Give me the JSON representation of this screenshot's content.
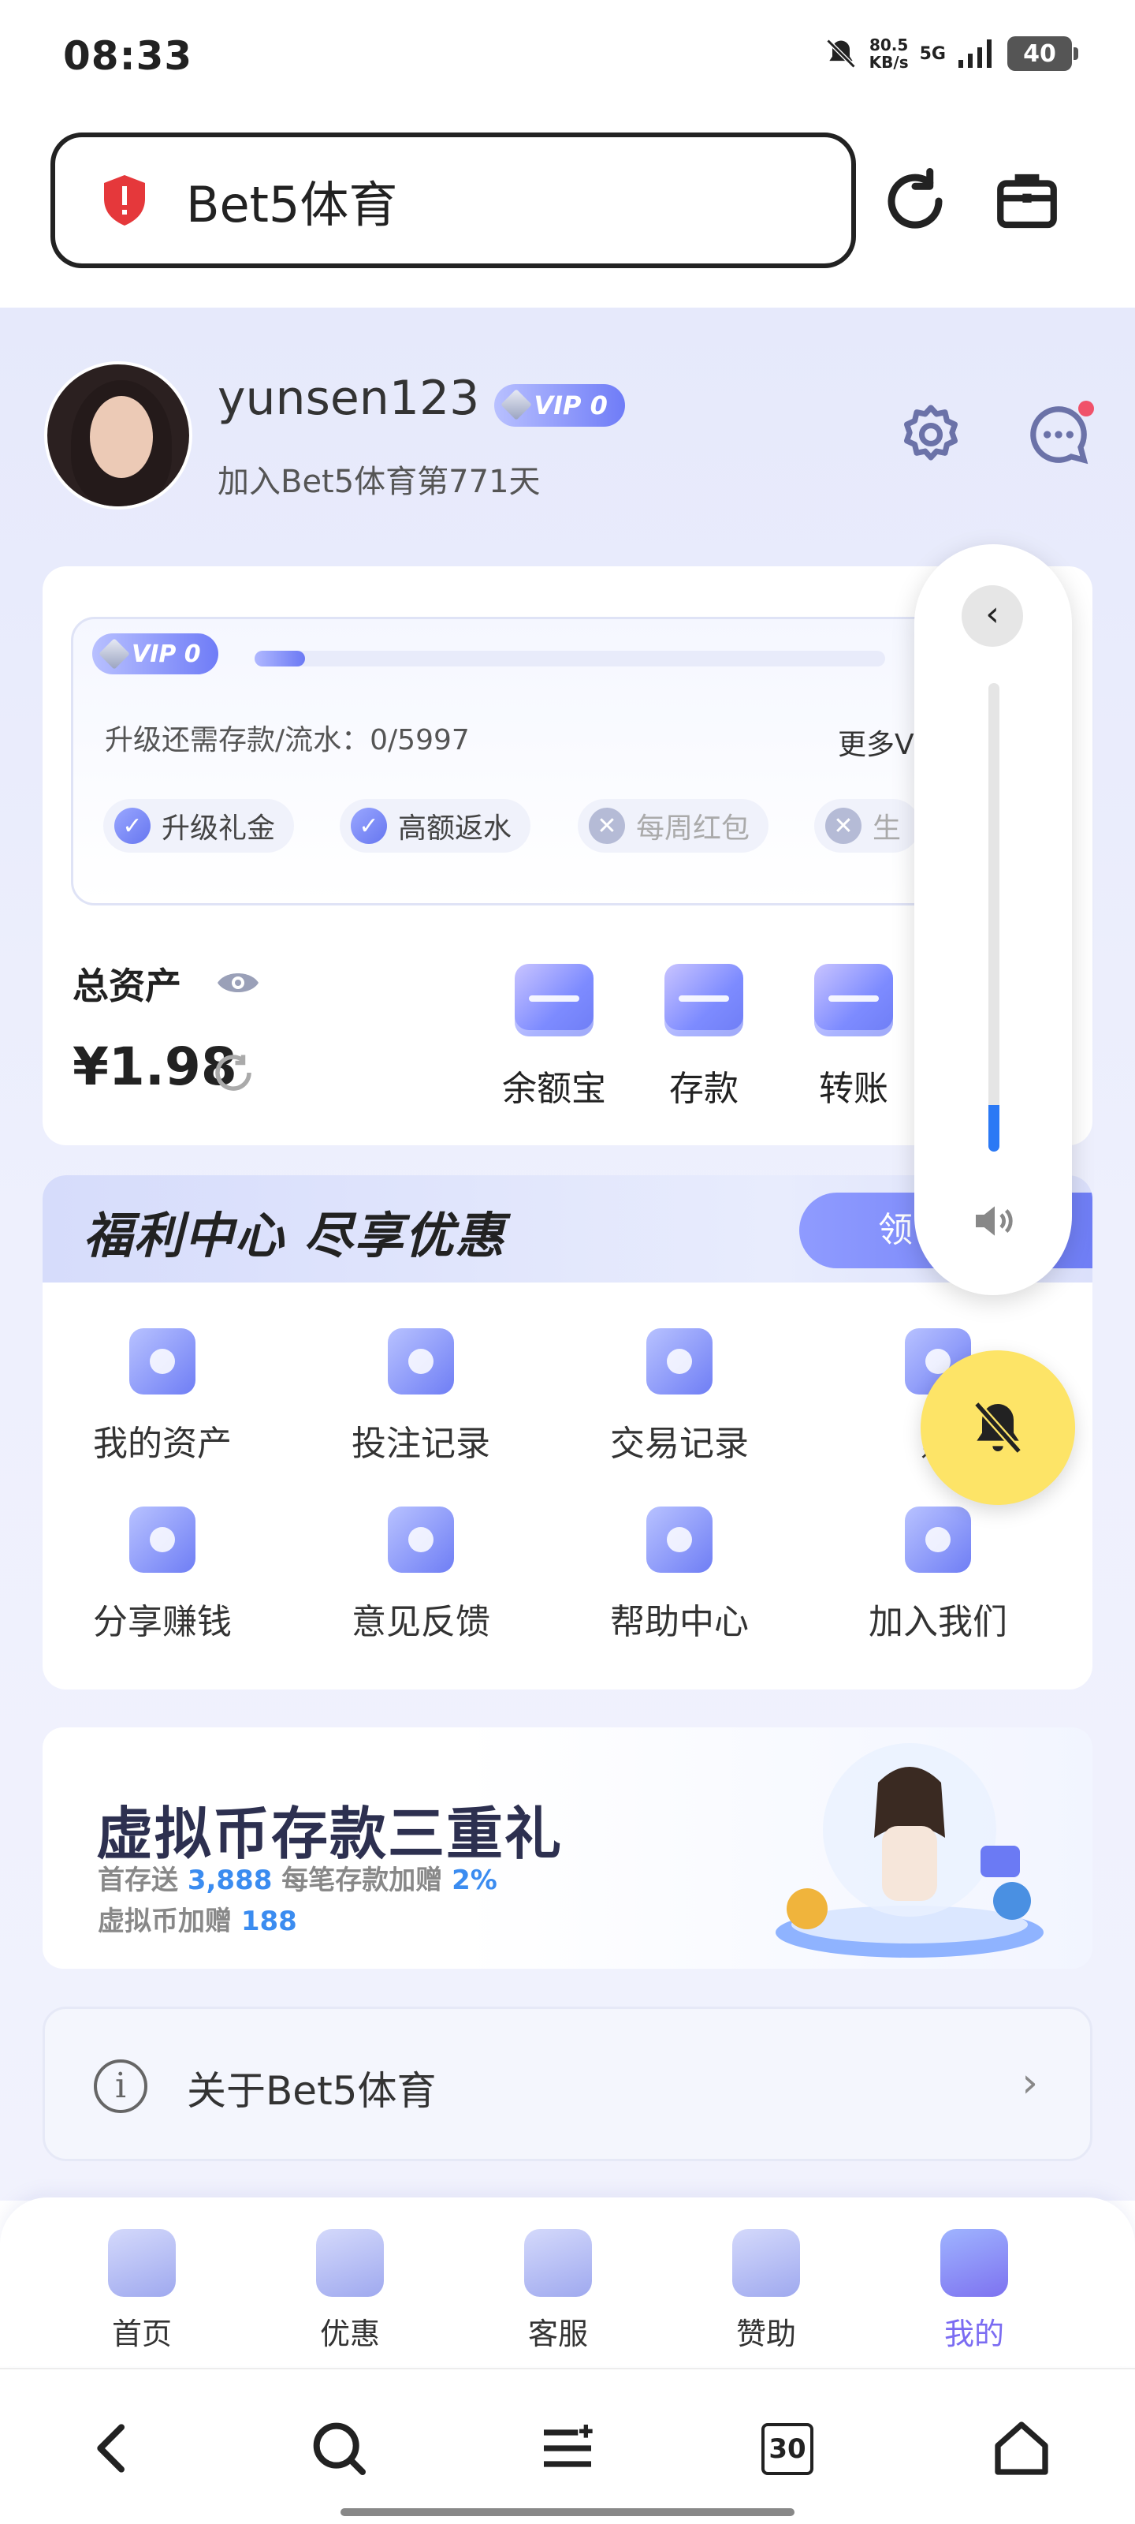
{
  "status_bar": {
    "time": "08:33",
    "speed_top": "80.5",
    "speed_unit": "KB/s",
    "network": "5G",
    "battery": "40"
  },
  "browser": {
    "site_title": "Bet5体育",
    "shield_color": "#e5383b"
  },
  "profile": {
    "username": "yunsen123",
    "vip_level": "VIP 0",
    "joined_text": "加入Bet5体育第771天"
  },
  "vip_card": {
    "badge": "VIP 0",
    "progress_fraction": 0.08,
    "upgrade_text": "升级还需存款/流水：0/5997",
    "more_text": "更多V",
    "perks": [
      {
        "label": "升级礼金",
        "enabled": true
      },
      {
        "label": "高额返水",
        "enabled": true
      },
      {
        "label": "每周红包",
        "enabled": false
      },
      {
        "label": "生",
        "enabled": false
      }
    ]
  },
  "assets": {
    "label": "总资产",
    "value": "¥1.98"
  },
  "quick_actions": [
    {
      "label": "余额宝",
      "icon": "yuebao-icon"
    },
    {
      "label": "存款",
      "icon": "deposit-icon"
    },
    {
      "label": "转账",
      "icon": "transfer-icon"
    }
  ],
  "welfare": {
    "title": "福利中心  尽享优惠",
    "button": "领",
    "items": [
      {
        "label": "我的资产",
        "icon": "assets-icon"
      },
      {
        "label": "投注记录",
        "icon": "bet-record-icon"
      },
      {
        "label": "交易记录",
        "icon": "transaction-icon"
      },
      {
        "label": "账",
        "icon": "account-icon"
      },
      {
        "label": "分享赚钱",
        "icon": "share-icon"
      },
      {
        "label": "意见反馈",
        "icon": "feedback-icon"
      },
      {
        "label": "帮助中心",
        "icon": "help-icon"
      },
      {
        "label": "加入我们",
        "icon": "join-icon"
      }
    ]
  },
  "banner": {
    "title": "虚拟币存款三重礼",
    "line1_a": "首存送 ",
    "line1_b": "3,888",
    "line1_c": " 每笔存款加赠 ",
    "line1_d": "2%",
    "line2_a": "虚拟币加赠 ",
    "line2_b": "188"
  },
  "about": {
    "label": "关于Bet5体育"
  },
  "tabs": [
    {
      "label": "首页",
      "active": false
    },
    {
      "label": "优惠",
      "active": false
    },
    {
      "label": "客服",
      "active": false
    },
    {
      "label": "赞助",
      "active": false
    },
    {
      "label": "我的",
      "active": true
    }
  ],
  "system_nav": {
    "tabs_count": "30"
  },
  "volume": {
    "level_fraction": 0.1
  }
}
